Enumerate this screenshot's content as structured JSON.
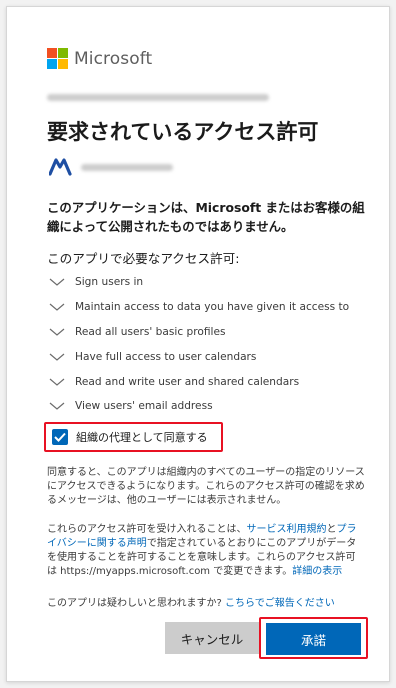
{
  "brand": {
    "name": "Microsoft",
    "colors": [
      "#f25022",
      "#7fba00",
      "#00a4ef",
      "#ffb900"
    ]
  },
  "title": "要求されているアクセス許可",
  "warning": "このアプリケーションは、Microsoft またはお客様の組織によって公開されたものではありません。",
  "permissions_heading": "このアプリで必要なアクセス許可:",
  "permissions": [
    {
      "label": "Sign users in"
    },
    {
      "label": "Maintain access to data you have given it access to"
    },
    {
      "label": "Read all users' basic profiles"
    },
    {
      "label": "Have full access to user calendars"
    },
    {
      "label": "Read and write user and shared calendars"
    },
    {
      "label": "View users' email address"
    }
  ],
  "consent": {
    "label": "組織の代理として同意する",
    "checked": true
  },
  "info1": "同意すると、このアプリは組織内のすべてのユーザーの指定のリソースにアクセスできるようになります。これらのアクセス許可の確認を求めるメッセージは、他のユーザーには表示されません。",
  "info2": {
    "part1": "これらのアクセス許可を受け入れることは、",
    "link1": "サービス利用規約",
    "part2": "と",
    "link2": "プライバシーに関する声明",
    "part3": "で指定されているとおりにこのアプリがデータを使用することを許可することを意味します。これらのアクセス許可は https://myapps.microsoft.com で変更できます。",
    "link3": "詳細の表示"
  },
  "suspicious": {
    "text": "このアプリは疑わしいと思われますか? ",
    "link": "こちらでご報告ください"
  },
  "buttons": {
    "cancel": "キャンセル",
    "accept": "承諾"
  },
  "accent": "#0067b8",
  "highlight": "#e81123"
}
